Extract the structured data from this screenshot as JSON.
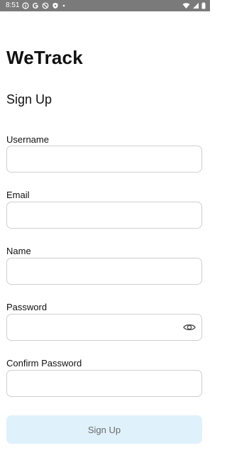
{
  "status_bar": {
    "time": "8:51",
    "icons_left": [
      "info-circle-icon",
      "google-icon",
      "no-disturb-icon",
      "shield-icon",
      "dot-icon"
    ],
    "icons_right": [
      "wifi-icon",
      "signal-icon",
      "battery-icon"
    ],
    "background": "#7a7a7a"
  },
  "app": {
    "title": "WeTrack",
    "subtitle": "Sign Up"
  },
  "form": {
    "fields": [
      {
        "label": "Username",
        "value": "",
        "placeholder": ""
      },
      {
        "label": "Email",
        "value": "",
        "placeholder": ""
      },
      {
        "label": "Name",
        "value": "",
        "placeholder": ""
      },
      {
        "label": "Password",
        "value": "",
        "placeholder": "",
        "trailing_icon": "eye-icon"
      },
      {
        "label": "Confirm Password",
        "value": "",
        "placeholder": ""
      }
    ],
    "submit_label": "Sign Up",
    "submit_color": "#dff1fb",
    "submit_enabled": false
  }
}
